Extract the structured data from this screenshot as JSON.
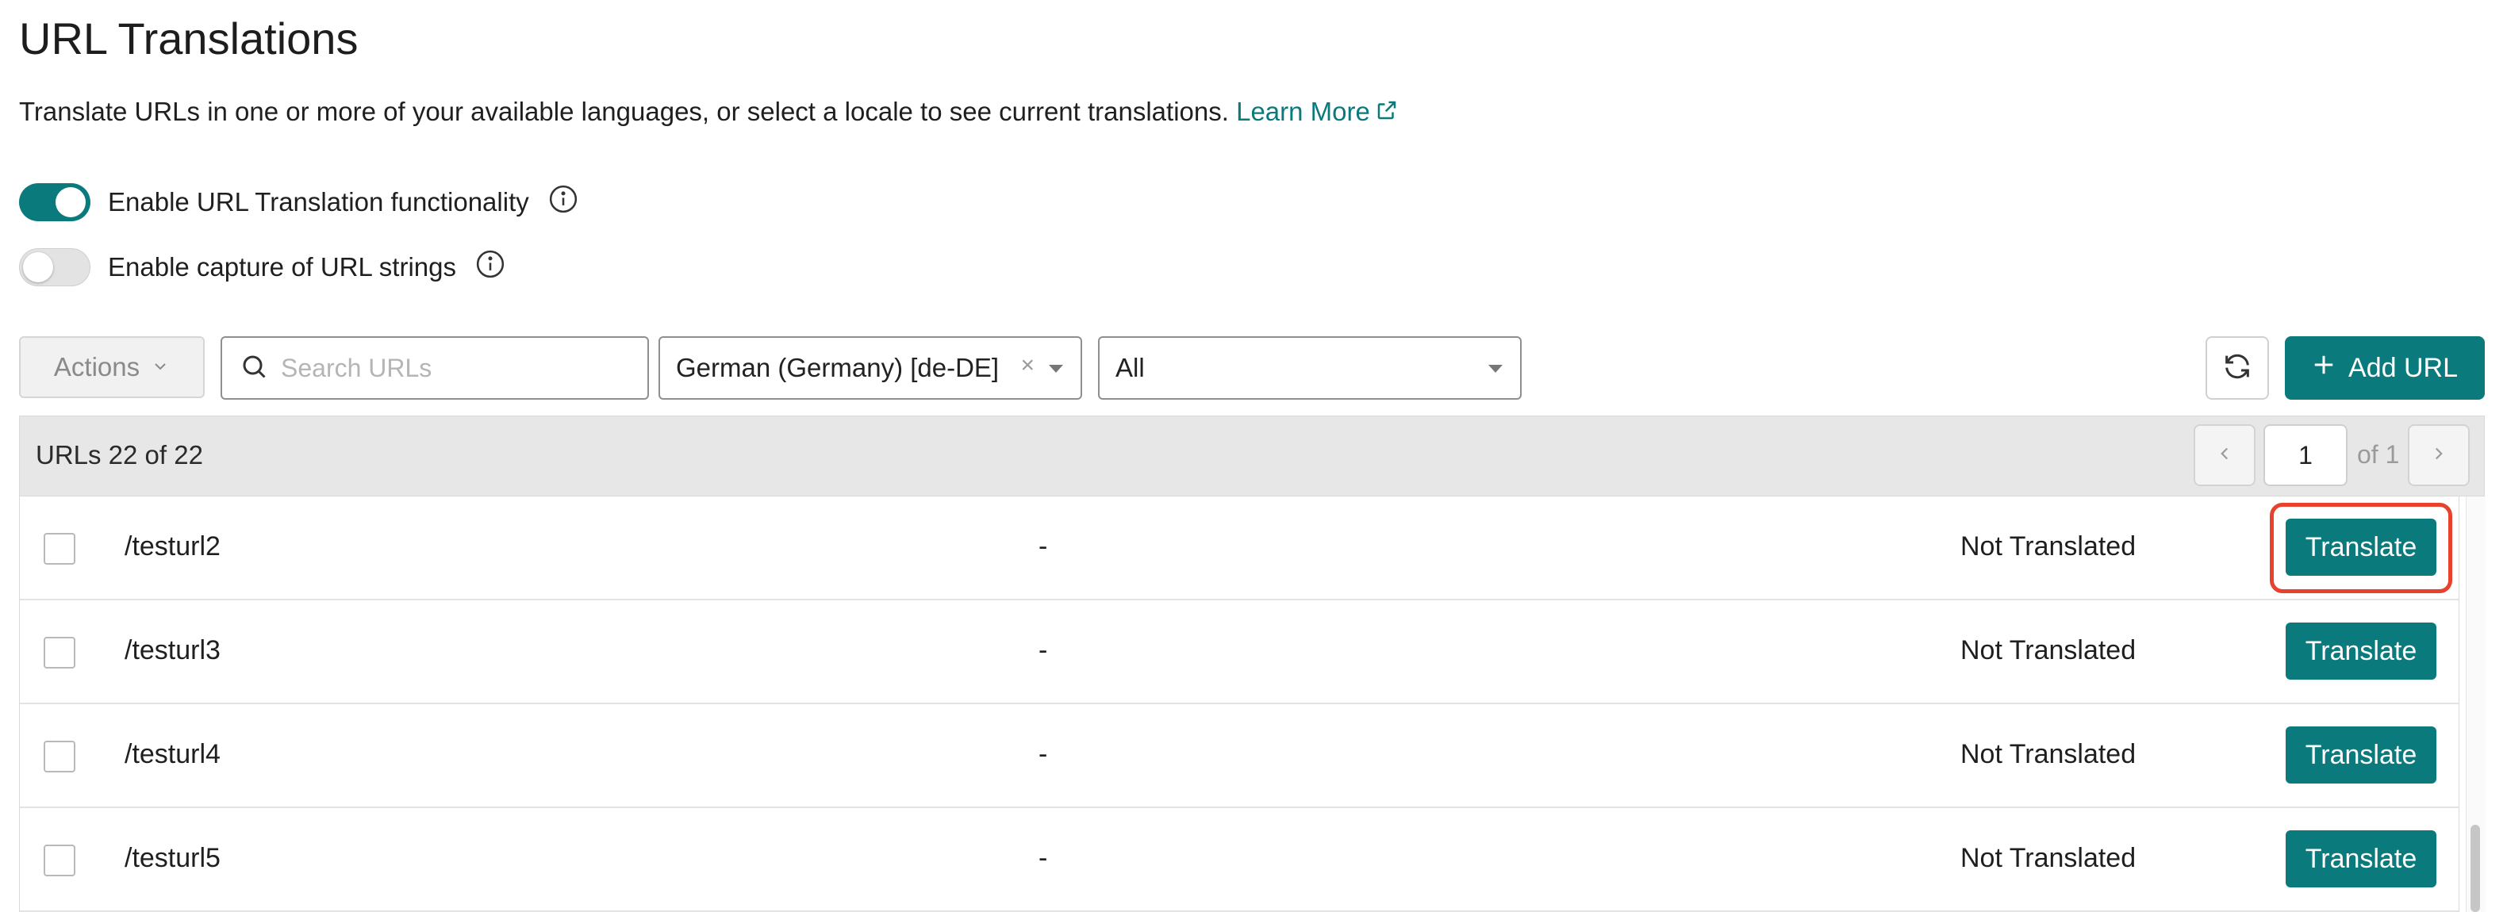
{
  "page": {
    "title": "URL Translations",
    "description": "Translate URLs in one or more of your available languages, or select a locale to see current translations.",
    "learn_more": "Learn More"
  },
  "toggles": [
    {
      "label": "Enable URL Translation functionality",
      "on": true
    },
    {
      "label": "Enable capture of URL strings",
      "on": false
    }
  ],
  "toolbar": {
    "actions_label": "Actions",
    "search_placeholder": "Search URLs",
    "locale_value": "German (Germany) [de-DE]",
    "clear_glyph": "×",
    "filter_value": "All",
    "add_url_label": "Add URL"
  },
  "table": {
    "count_label": "URLs 22 of 22",
    "page_input": "1",
    "page_of": "of 1",
    "rows": [
      {
        "url": "/testurl2",
        "translation": "-",
        "status": "Not Translated",
        "action": "Translate",
        "highlighted": true
      },
      {
        "url": "/testurl3",
        "translation": "-",
        "status": "Not Translated",
        "action": "Translate"
      },
      {
        "url": "/testurl4",
        "translation": "-",
        "status": "Not Translated",
        "action": "Translate"
      },
      {
        "url": "/testurl5",
        "translation": "-",
        "status": "Not Translated",
        "action": "Translate"
      }
    ]
  },
  "colors": {
    "accent": "#0b7a7d",
    "highlight": "#e8412e",
    "header_bg": "#e7e7e7"
  },
  "icons": [
    "external-link-icon",
    "info-icon",
    "chevron-down-icon",
    "search-icon",
    "refresh-icon",
    "plus-icon",
    "chevron-left-icon",
    "chevron-right-icon"
  ]
}
